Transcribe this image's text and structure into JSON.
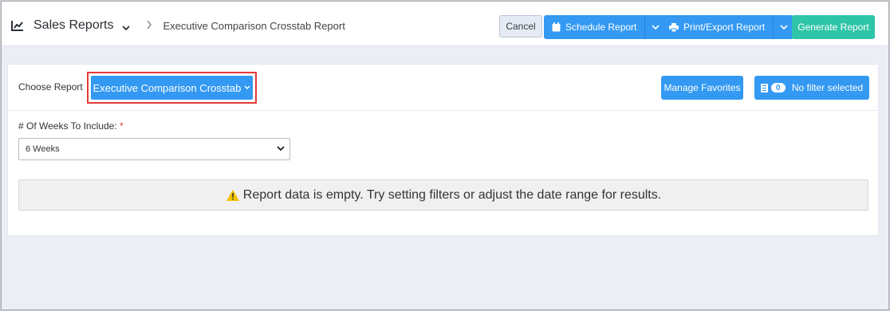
{
  "header": {
    "title": "Sales Reports",
    "breadcrumb": "Executive Comparison Crosstab Report",
    "cancel_label": "Cancel",
    "schedule_label": "Schedule Report",
    "print_label": "Print/Export Report",
    "generate_label": "Generate Report"
  },
  "report_panel": {
    "choose_label": "Choose Report",
    "selected_report": "Executive Comparison Crosstab",
    "manage_favorites_label": "Manage Favorites",
    "filter_count": "0",
    "filter_label": "No filter selected"
  },
  "weeks": {
    "label": "# Of Weeks To Include:",
    "required_mark": "*",
    "selected": "6 Weeks"
  },
  "empty_message": "Report data is empty. Try setting filters or adjust the date range for results.",
  "colors": {
    "primary": "#3399f2",
    "success": "#2ec4a7",
    "warning": "#f2c200",
    "highlight": "#e23b3b"
  },
  "icons": [
    "line-chart-icon",
    "chevron-down-icon",
    "chevron-right-icon",
    "calendar-icon",
    "printer-icon",
    "filter-icon",
    "warning-icon"
  ]
}
